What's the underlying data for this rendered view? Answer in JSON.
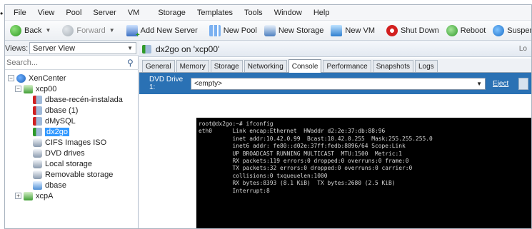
{
  "bullet": "•",
  "menubar": {
    "items": [
      "File",
      "View",
      "Pool",
      "Server",
      "VM",
      "Storage",
      "Templates",
      "Tools",
      "Window",
      "Help"
    ]
  },
  "toolbar": {
    "back": "Back",
    "forward": "Forward",
    "add_server": "Add New Server",
    "new_pool": "New Pool",
    "new_storage": "New Storage",
    "new_vm": "New VM",
    "shut_down": "Shut Down",
    "reboot": "Reboot",
    "suspend": "Suspend"
  },
  "views": {
    "label": "Views:",
    "selected": "Server View"
  },
  "search": {
    "placeholder": "Search..."
  },
  "tree": {
    "root": "XenCenter",
    "host1": "xcp00",
    "items": [
      "dbase-recén-instalada",
      "dbase (1)",
      "dMySQL",
      "dx2go",
      "CIFS Images ISO",
      "DVD drives",
      "Local storage",
      "Removable storage",
      "dbase"
    ],
    "host2": "xcpA"
  },
  "panel": {
    "title": "dx2go on 'xcp00'",
    "title_right": "Lo"
  },
  "tabs": [
    "General",
    "Memory",
    "Storage",
    "Networking",
    "Console",
    "Performance",
    "Snapshots",
    "Logs"
  ],
  "active_tab": "Console",
  "dvd": {
    "label": "DVD Drive 1:",
    "value": "<empty>",
    "eject": "Eject"
  },
  "terminal": {
    "lines": [
      "root@dx2go:~# ifconfig",
      "eth0      Link encap:Ethernet  HWaddr d2:2e:37:db:88:96",
      "          inet addr:10.42.0.99  Bcast:10.42.0.255  Mask:255.255.255.0",
      "          inet6 addr: fe80::d02e:37ff:fedb:8896/64 Scope:Link",
      "          UP BROADCAST RUNNING MULTICAST  MTU:1500  Metric:1",
      "          RX packets:119 errors:0 dropped:0 overruns:0 frame:0",
      "          TX packets:32 errors:0 dropped:0 overruns:0 carrier:0",
      "          collisions:0 txqueuelen:1000",
      "          RX bytes:8393 (8.1 KiB)  TX bytes:2680 (2.5 KiB)",
      "          Interrupt:8"
    ]
  },
  "colors": {
    "dvd_bar": "#2a71b4",
    "selection": "#3399ff",
    "terminal_bg": "#000000"
  }
}
